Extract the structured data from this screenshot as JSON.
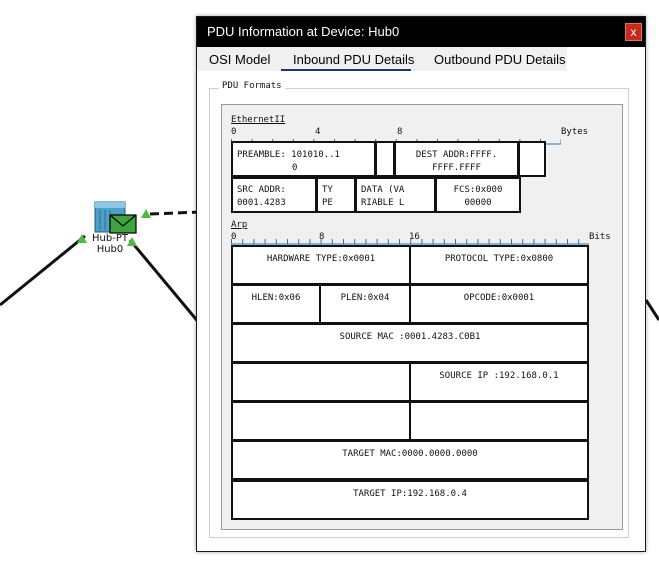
{
  "canvas": {
    "device_label_line1": "Hub-PT",
    "device_label_line2": "Hub0"
  },
  "dialog": {
    "title": "PDU Information at Device: Hub0",
    "close_label": "x",
    "tabs": [
      {
        "label": "OSI Model"
      },
      {
        "label": "Inbound PDU Details",
        "selected": true
      },
      {
        "label": "Outbound PDU Details"
      }
    ],
    "group_label": "PDU Formats",
    "ethernet": {
      "name": "EthernetII",
      "ruler_ticks": [
        "0",
        "4",
        "8"
      ],
      "ruler_unit": "Bytes",
      "preamble_line1": "PREAMBLE: 101010..1",
      "preamble_line2": "0",
      "dest_line1": "DEST ADDR:FFFF.",
      "dest_line2": "FFFF.FFFF",
      "src_line1": "SRC ADDR:",
      "src_line2": "0001.4283",
      "type_line1": "TY",
      "type_line2": "PE",
      "data_line1": "DATA (VA",
      "data_line2": "RIABLE L",
      "fcs_line1": "FCS:0x000",
      "fcs_line2": "00000"
    },
    "arp": {
      "name": "Arp",
      "ruler_ticks": [
        "0",
        "8",
        "16"
      ],
      "ruler_unit": "Bits",
      "hardware_type": "HARDWARE TYPE:0x0001",
      "protocol_type": "PROTOCOL TYPE:0x0800",
      "hlen": "HLEN:0x06",
      "plen": "PLEN:0x04",
      "opcode": "OPCODE:0x0001",
      "source_mac": "SOURCE MAC :0001.4283.C0B1",
      "source_ip": "SOURCE IP :192.168.0.1",
      "target_mac": "TARGET MAC:0000.0000.0000",
      "target_ip": "TARGET IP:192.168.0.4"
    }
  }
}
